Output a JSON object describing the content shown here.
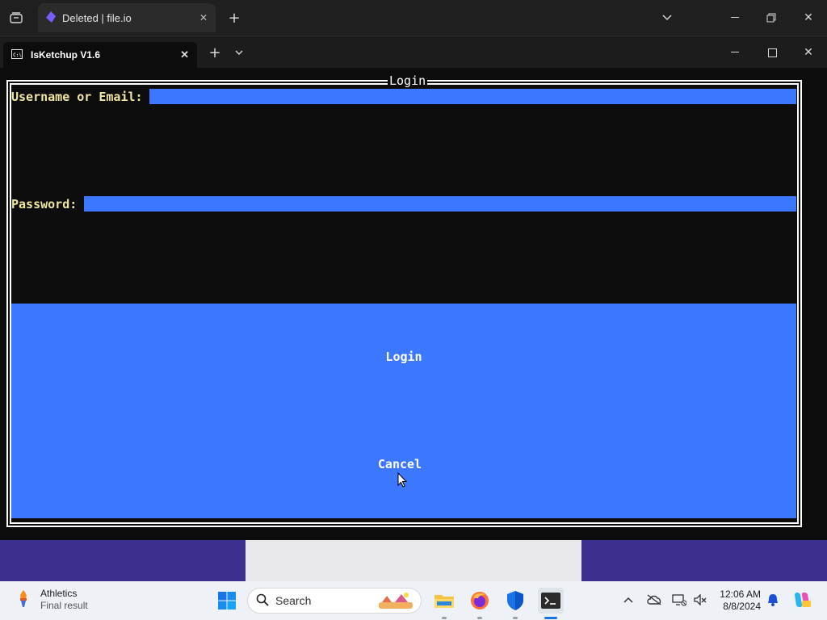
{
  "browser": {
    "tab_title": "Deleted | file.io"
  },
  "terminal": {
    "tab_title": "IsKetchup V1.6",
    "frame_title": "Login",
    "username_label": "Username or Email:",
    "username_value": "",
    "password_label": "Password:",
    "password_value": "",
    "login_button": "Login",
    "cancel_button": "Cancel"
  },
  "taskbar": {
    "widget_title": "Athletics",
    "widget_subtitle": "Final result",
    "search_placeholder": "Search",
    "time": "12:06 AM",
    "date": "8/8/2024",
    "pinned_apps": [
      "start-icon",
      "file-explorer-icon",
      "firefox-icon",
      "defender-icon",
      "terminal-icon"
    ]
  },
  "colors": {
    "accent_blue": "#3b78ff",
    "label_yellow": "#f0e6a0",
    "terminal_bg": "#0c0c0c",
    "desktop_purple": "#3b2f8f"
  }
}
